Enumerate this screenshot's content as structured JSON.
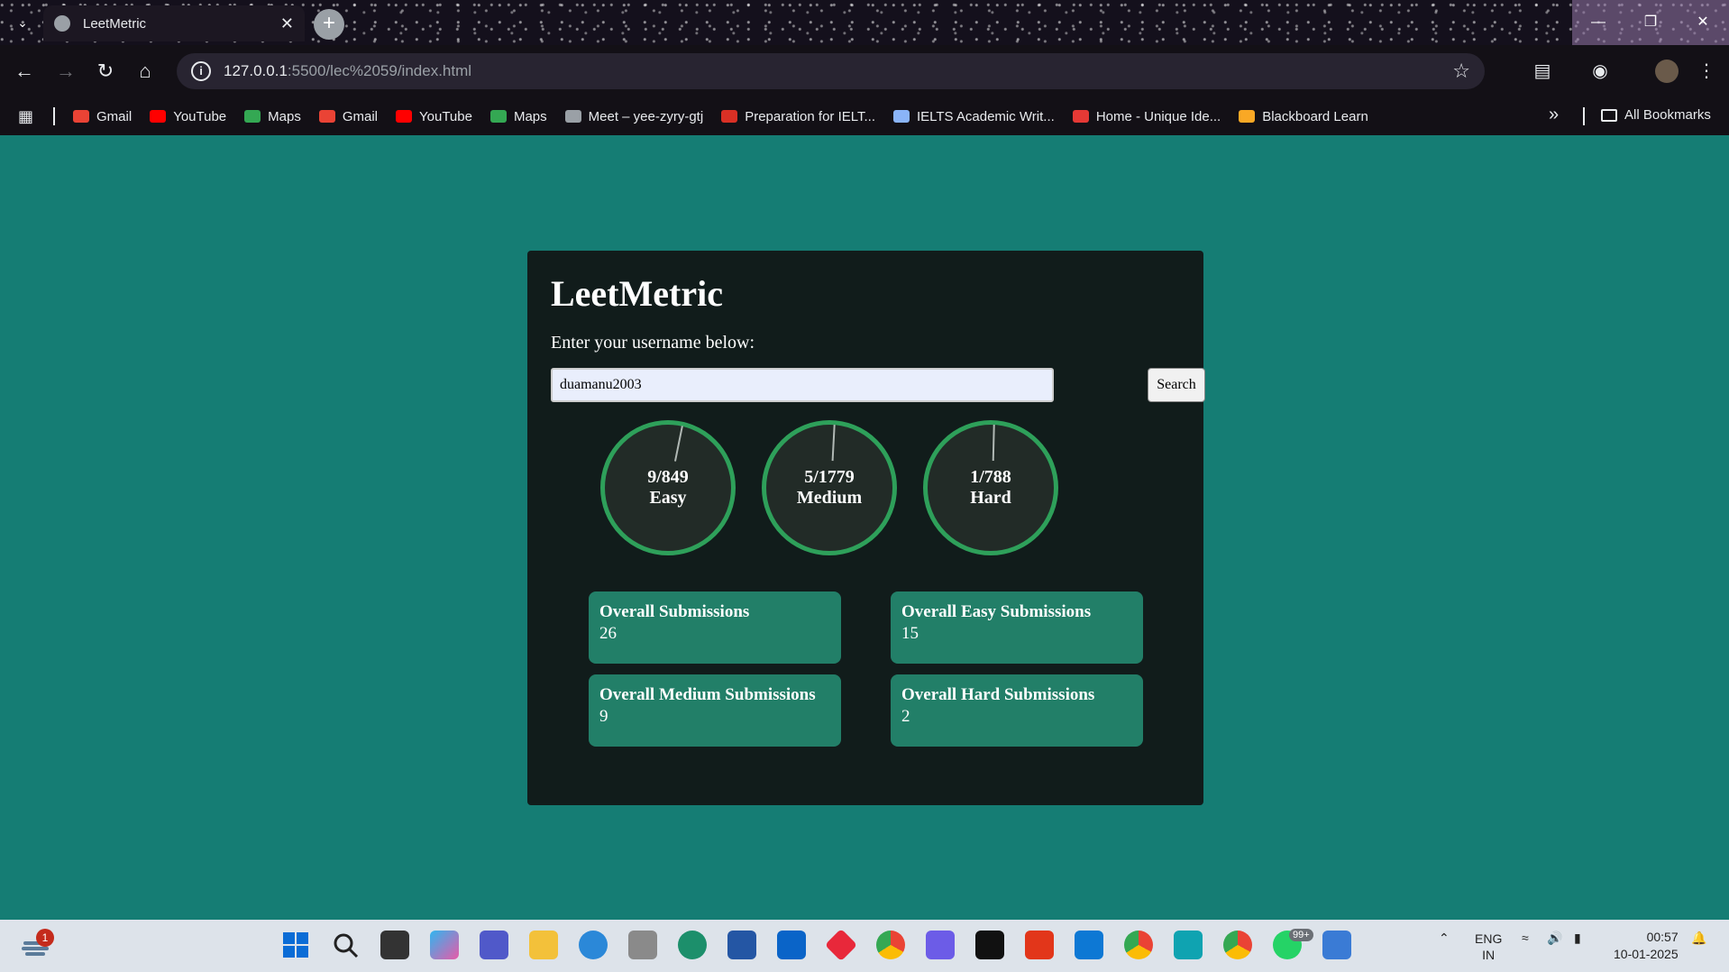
{
  "browser": {
    "tab_title": "LeetMetric",
    "url_host": "127.0.0.1",
    "url_path": ":5500/lec%2059/index.html",
    "bookmarks": [
      {
        "label": "Gmail",
        "color": "#ea4335"
      },
      {
        "label": "YouTube",
        "color": "#ff0000"
      },
      {
        "label": "Maps",
        "color": "#34a853"
      },
      {
        "label": "Gmail",
        "color": "#ea4335"
      },
      {
        "label": "YouTube",
        "color": "#ff0000"
      },
      {
        "label": "Maps",
        "color": "#34a853"
      },
      {
        "label": "Meet – yee-zyry-gtj",
        "color": "#9aa0a6"
      },
      {
        "label": "Preparation for IELT...",
        "color": "#d93025"
      },
      {
        "label": "IELTS Academic Writ...",
        "color": "#8ab4f8"
      },
      {
        "label": "Home - Unique Ide...",
        "color": "#e53935"
      },
      {
        "label": "Blackboard Learn",
        "color": "#f9a825"
      }
    ],
    "all_bookmarks_label": "All Bookmarks"
  },
  "app": {
    "title": "LeetMetric",
    "prompt": "Enter your username below:",
    "search_value": "duamanu2003",
    "search_button": "Search",
    "progress": [
      {
        "solved": "9/849",
        "level": "Easy",
        "fraction": 0.0106
      },
      {
        "solved": "5/1779",
        "level": "Medium",
        "fraction": 0.0028
      },
      {
        "solved": "1/788",
        "level": "Hard",
        "fraction": 0.0013
      }
    ],
    "stats": [
      {
        "label": "Overall Submissions",
        "value": "26"
      },
      {
        "label": "Overall Easy Submissions",
        "value": "15"
      },
      {
        "label": "Overall Medium Submissions",
        "value": "9"
      },
      {
        "label": "Overall Hard Submissions",
        "value": "2"
      }
    ]
  },
  "taskbar": {
    "weather_badge": "1",
    "whatsapp_badge": "99+",
    "language": "ENG",
    "region": "IN",
    "time": "00:57",
    "date": "10-01-2025"
  }
}
